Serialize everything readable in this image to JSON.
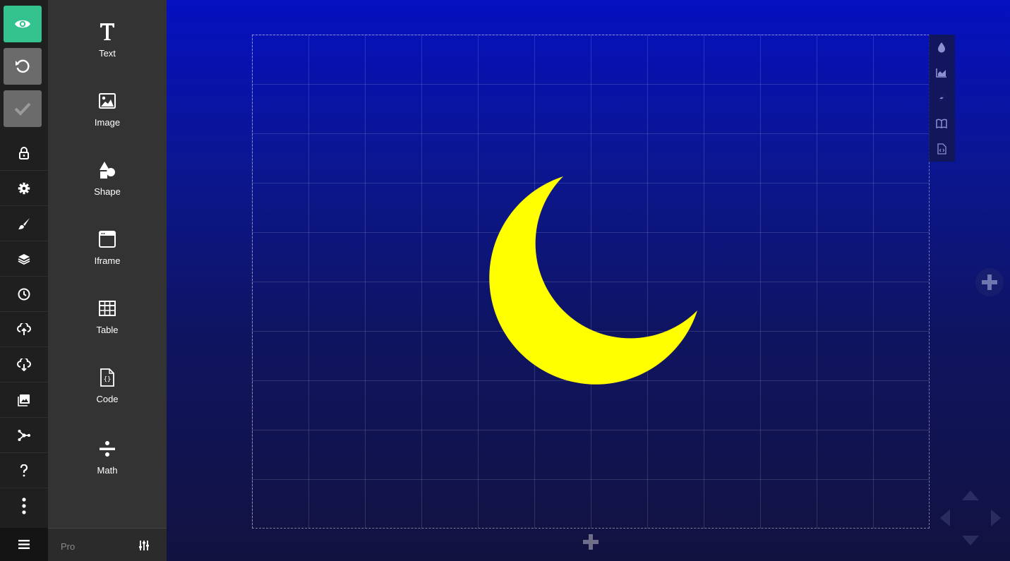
{
  "rail": {
    "preview_icon": "eye-icon",
    "undo_icon": "undo-icon",
    "confirm_icon": "check-icon",
    "items": [
      {
        "name": "lock",
        "icon": "lock-icon"
      },
      {
        "name": "settings",
        "icon": "gear-icon"
      },
      {
        "name": "style",
        "icon": "brush-icon"
      },
      {
        "name": "layers",
        "icon": "layers-icon"
      },
      {
        "name": "history",
        "icon": "clock-icon"
      },
      {
        "name": "upload",
        "icon": "cloud-upload-icon"
      },
      {
        "name": "download",
        "icon": "cloud-download-icon"
      },
      {
        "name": "media",
        "icon": "images-icon"
      },
      {
        "name": "share",
        "icon": "share-icon"
      },
      {
        "name": "help",
        "icon": "question-icon"
      },
      {
        "name": "more",
        "icon": "more-vertical-icon"
      }
    ],
    "menu_icon": "hamburger-icon"
  },
  "palette": {
    "blocks": [
      {
        "label": "Text",
        "icon": "text-icon"
      },
      {
        "label": "Image",
        "icon": "image-icon"
      },
      {
        "label": "Shape",
        "icon": "shapes-icon"
      },
      {
        "label": "Iframe",
        "icon": "iframe-icon"
      },
      {
        "label": "Table",
        "icon": "table-icon"
      },
      {
        "label": "Code",
        "icon": "code-file-icon"
      },
      {
        "label": "Math",
        "icon": "divide-icon"
      }
    ],
    "footer": {
      "pro_label": "Pro",
      "settings_icon": "sliders-icon"
    }
  },
  "stage": {
    "shape_color": "#ffff00",
    "background_top": "#0510c0",
    "background_bottom": "#121240",
    "canvas_tools": [
      {
        "name": "color",
        "icon": "droplet-icon"
      },
      {
        "name": "chart",
        "icon": "area-chart-icon"
      },
      {
        "name": "animation",
        "icon": "bolt-icon"
      },
      {
        "name": "notes",
        "icon": "book-icon"
      },
      {
        "name": "export",
        "icon": "code-file-icon"
      }
    ],
    "accent": "#34c38f"
  }
}
